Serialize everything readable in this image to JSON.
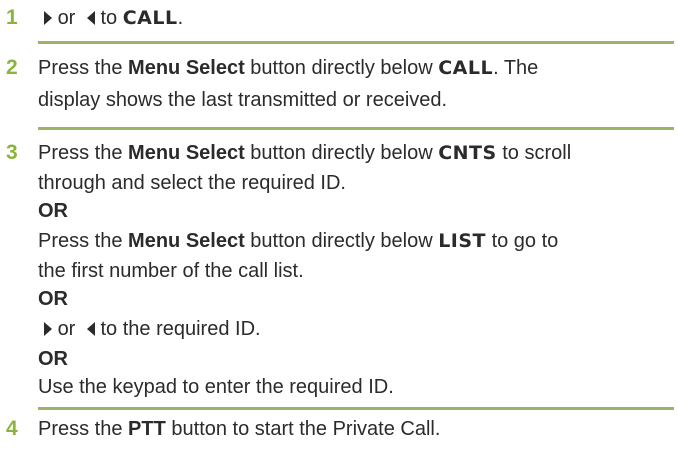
{
  "steps": [
    {
      "number": "1",
      "or": "or",
      "to": "to",
      "display_call": "CALL",
      "period": "."
    },
    {
      "number": "2",
      "text_a": "Press the ",
      "bold_menu": "Menu Select",
      "text_b": " button directly below ",
      "display_call": "CALL",
      "text_c": ". The",
      "line2": "display shows the last transmitted or received."
    },
    {
      "number": "3",
      "text_a": "Press the ",
      "bold_menu": "Menu Select",
      "text_b": " button directly below ",
      "display_cnts": "CNTS",
      "text_c": " to scroll",
      "line2": "through and select the required ID.",
      "or_1": "OR",
      "line4_a": "Press the ",
      "line4_bold": "Menu Select",
      "line4_b": " button directly below ",
      "display_list": "LIST",
      "line4_c": " to go to",
      "line5": "the first number of the call list.",
      "or_2": "OR",
      "line7_or": "or",
      "line7_to": "to the required ID.",
      "or_3": "OR",
      "line9": "Use the keypad to enter the required ID."
    },
    {
      "number": "4",
      "text_a": "Press the ",
      "bold_ptt": "PTT",
      "text_b": " button to start the Private Call."
    }
  ],
  "colors": {
    "accent": "#8cb43c",
    "divider": "#9cb46a",
    "text": "#2b2b2b"
  }
}
